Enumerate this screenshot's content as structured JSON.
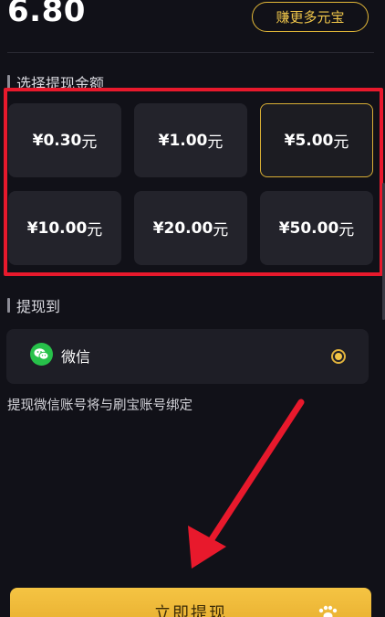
{
  "balance": {
    "value": "6.80"
  },
  "earn_button": {
    "label": "赚更多元宝"
  },
  "amount_section": {
    "title": "选择提现金额",
    "options": [
      {
        "amount": "¥0.30",
        "unit": "元",
        "selected": false
      },
      {
        "amount": "¥1.00",
        "unit": "元",
        "selected": false
      },
      {
        "amount": "¥5.00",
        "unit": "元",
        "selected": true
      },
      {
        "amount": "¥10.00",
        "unit": "元",
        "selected": false
      },
      {
        "amount": "¥20.00",
        "unit": "元",
        "selected": false
      },
      {
        "amount": "¥50.00",
        "unit": "元",
        "selected": false
      }
    ]
  },
  "withdraw_section": {
    "title": "提现到",
    "method": {
      "label": "微信",
      "icon": "wechat-icon",
      "selected": true
    }
  },
  "notice": "提现微信账号将与刷宝账号绑定",
  "submit_button": {
    "label": "立即提现",
    "icon": "paw-icon"
  },
  "colors": {
    "accent": "#f0c64a",
    "highlight": "#e8192c",
    "background": "#111118",
    "card": "#23232b",
    "wechat": "#27c14a"
  }
}
